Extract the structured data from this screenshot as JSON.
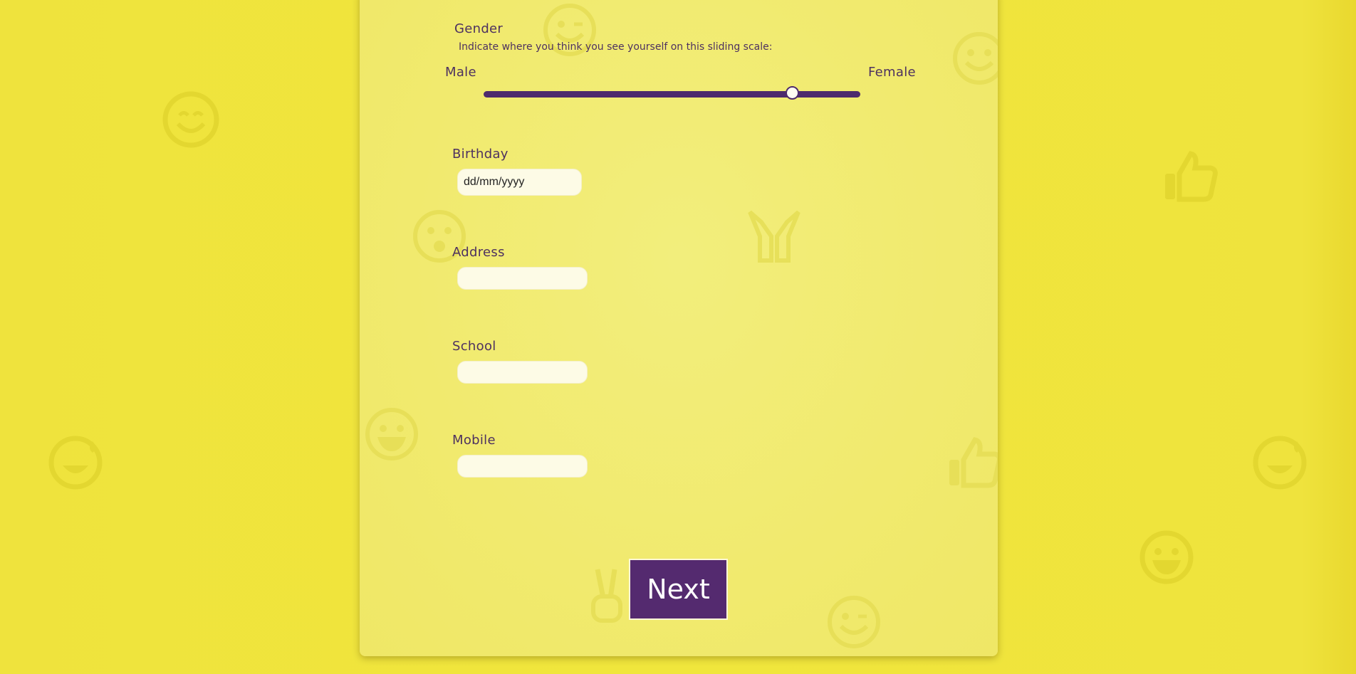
{
  "colors": {
    "background": "#efe33d",
    "card": "#f1ea6e",
    "accent": "#542a6f",
    "field": "#fdfbe6",
    "text": "#4d3160"
  },
  "gender": {
    "label": "Gender",
    "hint": "Indicate where you think you see yourself on this sliding scale:",
    "min_label": "Male",
    "max_label": "Female",
    "value": 0.82
  },
  "birthday": {
    "label": "Birthday",
    "placeholder": "dd/mm/yyyy"
  },
  "address": {
    "label": "Address",
    "value": ""
  },
  "school": {
    "label": "School",
    "value": ""
  },
  "mobile": {
    "label": "Mobile",
    "value": ""
  },
  "next_button": {
    "label": "Next"
  },
  "background_icons": [
    "smile-icon",
    "wink-icon",
    "surprised-icon",
    "grin-icon",
    "laugh-tears-icon",
    "thumbs-up-icon",
    "praying-hands-icon",
    "peace-sign-icon"
  ]
}
